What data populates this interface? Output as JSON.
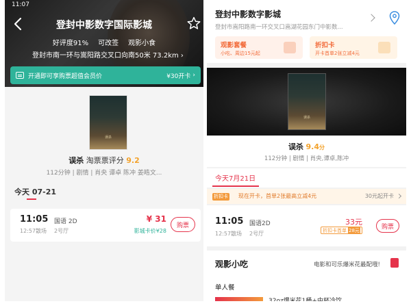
{
  "left": {
    "status_time": "11:07",
    "cinema_title": "登封中影数字国际影城",
    "tags": [
      "好评度91%",
      "可改签",
      "观影小食"
    ],
    "address": "登封市南一环与嵩阳路交叉口向南50米",
    "distance": "73.2km",
    "vip_text": "开通即可享购票超值会员价",
    "vip_price": "¥30开卡",
    "movie_title": "误杀",
    "rating_label": "淘票票评分",
    "rating": "9.2",
    "movie_info": "112分钟 | 剧情 | 肖央 谭卓 陈冲 姜皓文...",
    "date_label": "今天 07-21",
    "showtime": {
      "start": "11:05",
      "end": "12:57散场",
      "language": "国语 2D",
      "hall": "2号厅",
      "price": "¥ 31",
      "card_price": "影城卡价¥28",
      "buy_label": "购票"
    }
  },
  "right": {
    "cinema_title": "登封中影数字影城",
    "address": "登封市嵩阳路南一环交叉口嵩湖花园东门中影数...",
    "promo_boxes": [
      {
        "title": "观影套餐",
        "subtitle": "小吃、周边15元起"
      },
      {
        "title": "折扣卡",
        "subtitle": "开卡首单2张立减4元"
      }
    ],
    "movie_title": "误杀",
    "rating": "9.4",
    "rating_unit": "分",
    "movie_info": "112分钟 | 剧情 | 肖央,谭卓,陈冲",
    "date_label": "今天7月21日",
    "promo_tag": "折扣卡",
    "promo_text": "现在开卡，首单2张最高立减4元",
    "promo_right": "30元起开卡",
    "showtime": {
      "start": "11:05",
      "end": "12:57散场",
      "language": "国语2D",
      "hall": "2号厅",
      "price": "33元",
      "card_label": "折扣卡首单",
      "card_value": "28元",
      "buy_label": "购票"
    },
    "snack_title": "观影小吃",
    "snack_desc": "电影和可乐爆米花最配哦!",
    "single_label": "单人餐",
    "item_text": "32oz爆米花1桶+中杯冷饮"
  },
  "poster_text": "误杀",
  "colors": {
    "accent": "#e5334b",
    "vip_green": "#2fb39a",
    "rating_orange": "#f3a22b",
    "promo_orange": "#f26b3a"
  }
}
